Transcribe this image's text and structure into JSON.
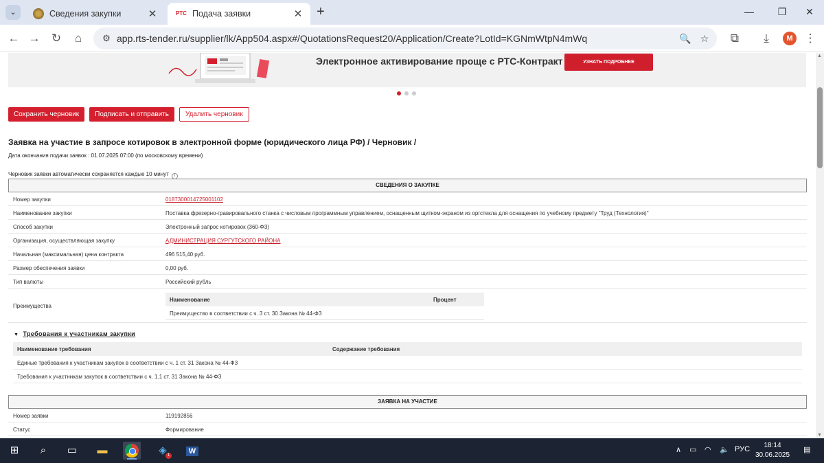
{
  "browser": {
    "tabs": [
      {
        "title": "Сведения закупки",
        "active": false
      },
      {
        "title": "Подача заявки",
        "active": true,
        "favicon_text": "РТС"
      }
    ],
    "url": "app.rts-tender.ru/supplier/lk/App504.aspx#/QuotationsRequest20/Application/Create?LotId=KGNmWtpN4mWq",
    "profile_initial": "M"
  },
  "banner": {
    "text": "Электронное активирование проще с РТС-Контракт",
    "button": "УЗНАТЬ ПОДРОБНЕЕ"
  },
  "actions": {
    "save": "Сохранить черновик",
    "sign": "Подписать и отправить",
    "delete": "Удалить черновик"
  },
  "heading": "Заявка на участие в запросе котировок в электронной форме (юридического лица РФ)  / Черновик /",
  "deadline": "Дата окончания подачи заявок : 01.07.2025 07:00 (по московскому времени)",
  "autosave": "Черновик заявки автоматически сохраняется каждые 10 минут",
  "procurement": {
    "title": "СВЕДЕНИЯ О ЗАКУПКЕ",
    "rows": [
      {
        "label": "Номер закупки",
        "value": "0187300014725001102"
      },
      {
        "label": "Наименование закупки",
        "value": "Поставка фрезерно-гравировального станка с числовым программным управлением, оснащенным щитком-экраном из оргстекла для оснащения по учебному предмету \"Труд (Технология)\""
      },
      {
        "label": "Способ закупки",
        "value": "Электронный запрос котировок (360-ФЗ)"
      },
      {
        "label": "Организация, осуществляющая закупку",
        "value": "АДМИНИСТРАЦИЯ СУРГУТСКОГО РАЙОНА"
      },
      {
        "label": "Начальная (максимальная) цена контракта",
        "value": "496 515,40 руб."
      },
      {
        "label": "Размер обеспечения заявки",
        "value": "0,00 руб."
      },
      {
        "label": "Тип валюты",
        "value": "Российский рубль"
      },
      {
        "label": "Преимущества",
        "value": ""
      }
    ],
    "advantages": {
      "headers": [
        "Наименование",
        "Процент"
      ],
      "rows": [
        [
          "Преимущество в соответствии с ч. 3 ст. 30 Закона № 44-ФЗ",
          ""
        ]
      ]
    }
  },
  "requirements": {
    "title": "Требования к участникам закупки",
    "headers": [
      "Наименование требования",
      "Содержание требования"
    ],
    "rows": [
      "Единые требования к участникам закупок в соответствии с ч. 1 ст. 31 Закона № 44-ФЗ",
      "Требования к участникам закупок в соответствии с ч. 1.1 ст. 31 Закона № 44-ФЗ"
    ]
  },
  "application": {
    "title": "ЗАЯВКА НА УЧАСТИЕ",
    "rows": [
      {
        "label": "Номер заявки",
        "value": "119192856"
      },
      {
        "label": "Статус",
        "value": "Формирование"
      }
    ]
  },
  "taskbar": {
    "language": "РУС",
    "time": "18:14",
    "date": "30.06.2025",
    "badge": "1"
  },
  "colors": {
    "accent": "#d4202e",
    "tabstrip": "#dfe6f2",
    "taskbar": "#1c2433"
  }
}
